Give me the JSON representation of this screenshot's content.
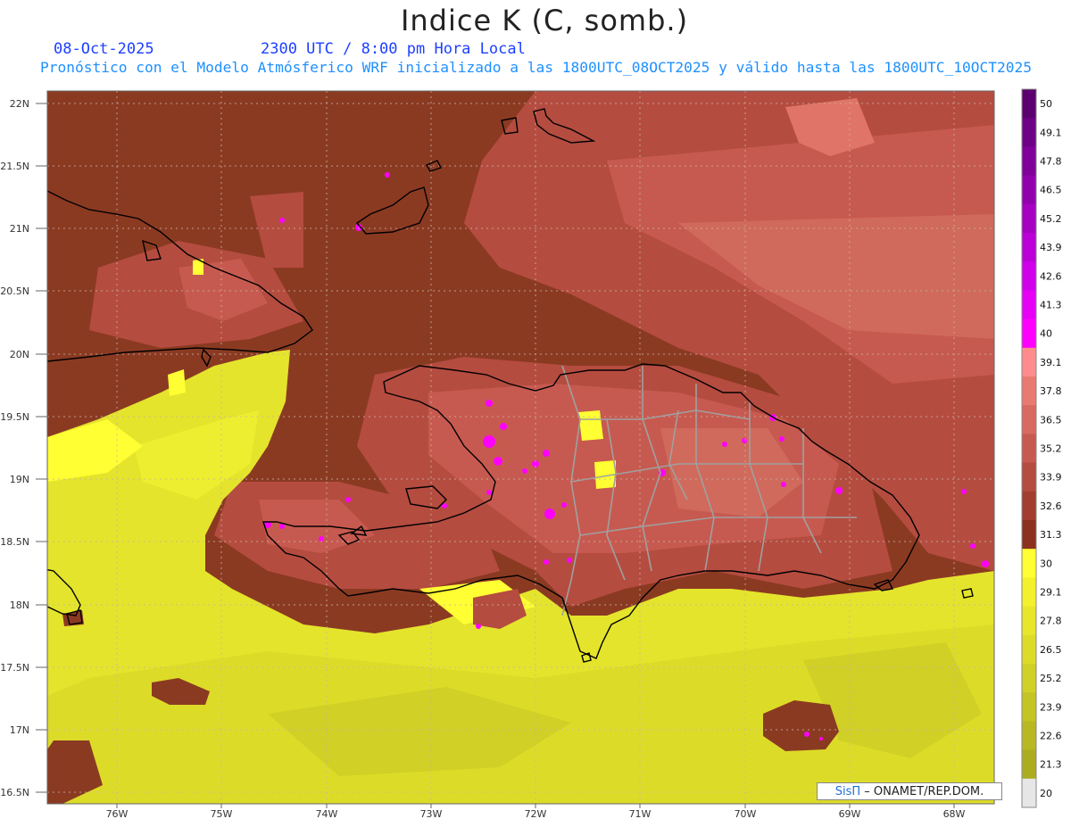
{
  "title": "Indice K (C, somb.)",
  "date": "08-Oct-2025",
  "time_label": "2300 UTC / 8:00 pm Hora Local",
  "model_label": "Pronóstico con el Modelo Atmósferico WRF inicializado a las 1800UTC_08OCT2025 y válido hasta las  1800UTC_10OCT2025",
  "credit": {
    "brand": "SisΠ",
    "text": "– ONAMET/REP.DOM."
  },
  "lat_labels": [
    "22N",
    "21.5N",
    "21N",
    "20.5N",
    "20N",
    "19.5N",
    "19N",
    "18.5N",
    "18N",
    "17.5N",
    "17N",
    "16.5N"
  ],
  "lon_labels": [
    "76W",
    "75W",
    "74W",
    "73W",
    "72W",
    "71W",
    "70W",
    "69W",
    "68W"
  ],
  "colorbar": {
    "labels": [
      "50",
      "49.1",
      "47.8",
      "46.5",
      "45.2",
      "43.9",
      "42.6",
      "41.3",
      "40",
      "39.1",
      "37.8",
      "36.5",
      "35.2",
      "33.9",
      "32.6",
      "31.3",
      "30",
      "29.1",
      "27.8",
      "26.5",
      "25.2",
      "23.9",
      "22.6",
      "21.3",
      "20"
    ],
    "colors": [
      "#5c0070",
      "#6e0085",
      "#80009a",
      "#9200ae",
      "#a600c2",
      "#ba00d6",
      "#d000ea",
      "#e600f6",
      "#ff00ff",
      "#ff8c8c",
      "#e87a72",
      "#d96a62",
      "#c75a50",
      "#b54c40",
      "#a23e30",
      "#8c3020",
      "#ffff33",
      "#f3f12c",
      "#e8e62a",
      "#dcdc28",
      "#d0d026",
      "#c4c424",
      "#b8b822",
      "#acac20",
      "#e6e6e6"
    ]
  },
  "map_colors": {
    "ocean_south": "#e4e42c",
    "ocean_north": "#8b3a22",
    "land_warm": "#c0584a",
    "hot_spot": "#ff00ff",
    "coast": "#000000",
    "province_border": "#a0a0a0"
  }
}
